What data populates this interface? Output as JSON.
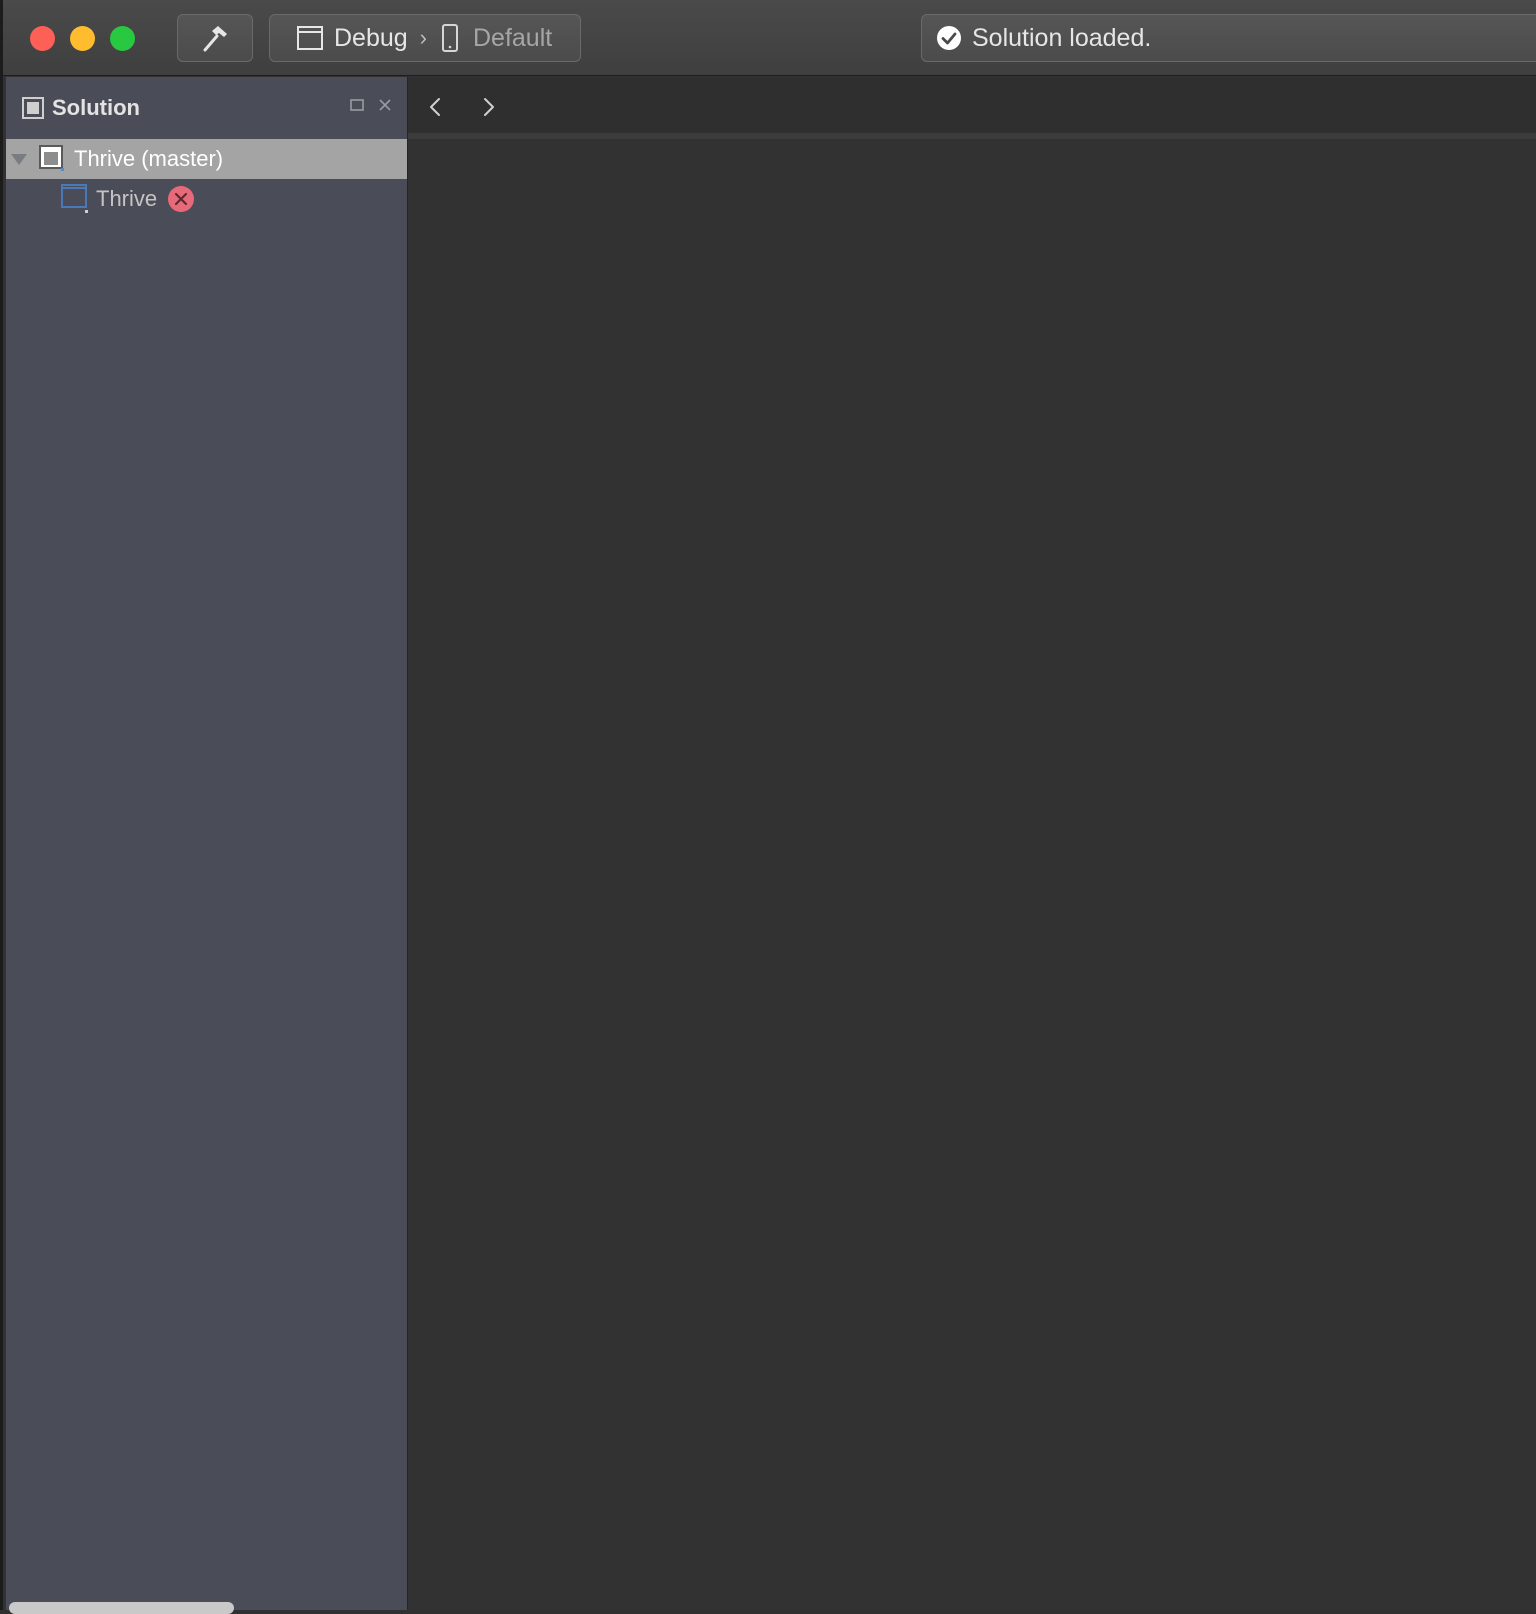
{
  "toolbar": {
    "configuration": "Debug",
    "device": "Default",
    "status": "Solution loaded."
  },
  "solution_pad": {
    "title": "Solution",
    "items": [
      {
        "label": "Thrive (master)",
        "type": "solution",
        "expanded": true,
        "selected": true
      },
      {
        "label": "Thrive",
        "type": "project",
        "status": "error"
      }
    ]
  },
  "colors": {
    "close_light": "#fe5f57",
    "minimize_light": "#febc2e",
    "zoom_light": "#28c840",
    "error_badge": "#e8697a",
    "project_icon_border": "#4a79b8",
    "sidebar_bg": "#4a4d58",
    "selected_row_bg": "#a4a4a4"
  },
  "icons": [
    "hammer-icon",
    "window-icon",
    "phone-icon",
    "check-circle-icon",
    "solution-icon",
    "project-icon",
    "error-icon",
    "chevron-left-icon",
    "chevron-right-icon"
  ]
}
